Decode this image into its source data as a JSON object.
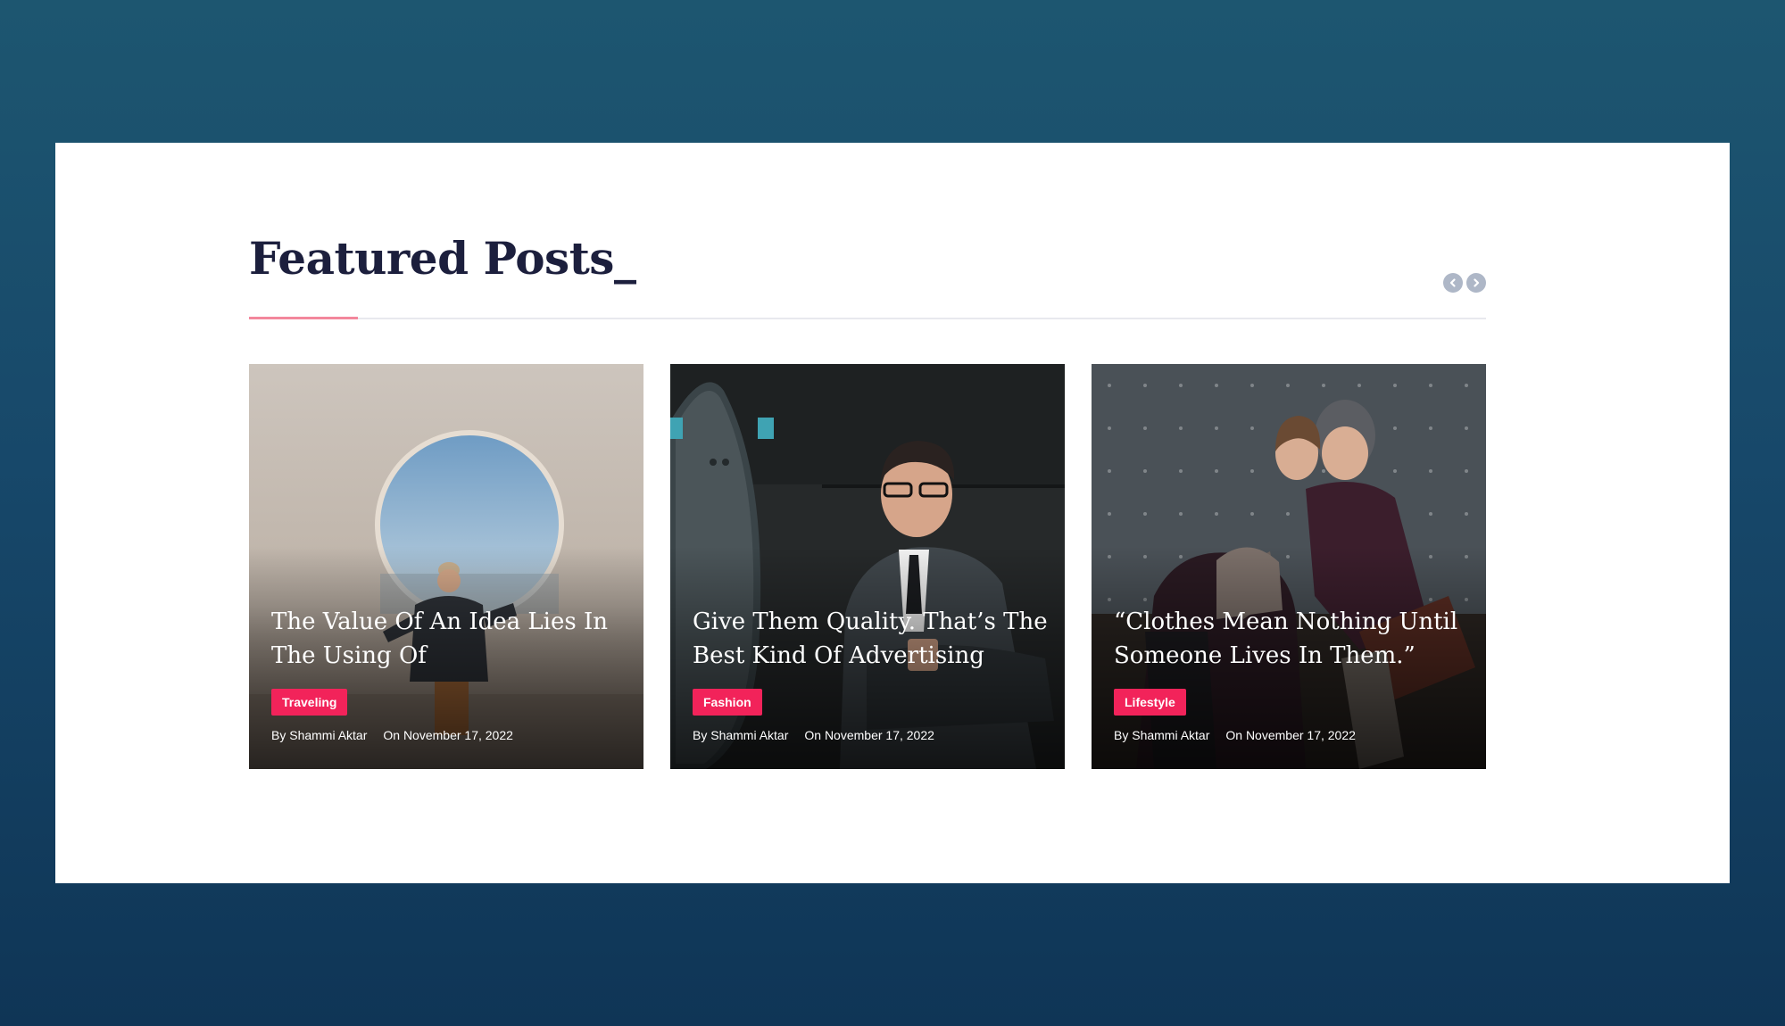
{
  "section": {
    "title": "Featured Posts_",
    "accent_color": "#f3879c",
    "nav_icons": [
      "chevron-left-icon",
      "chevron-right-icon"
    ]
  },
  "tag_color": "#f2235a",
  "posts": [
    {
      "title": "The Value Of An Idea Lies In The Using Of",
      "category": "Traveling",
      "author": "By Shammi Aktar",
      "date": "On November 17, 2022"
    },
    {
      "title": "Give Them Quality. That’s The Best Kind Of Advertising",
      "category": "Fashion",
      "author": "By Shammi Aktar",
      "date": "On November 17, 2022"
    },
    {
      "title": "“Clothes Mean Nothing Until Someone Lives In Them.”",
      "category": "Lifestyle",
      "author": "By Shammi Aktar",
      "date": "On November 17, 2022"
    }
  ]
}
